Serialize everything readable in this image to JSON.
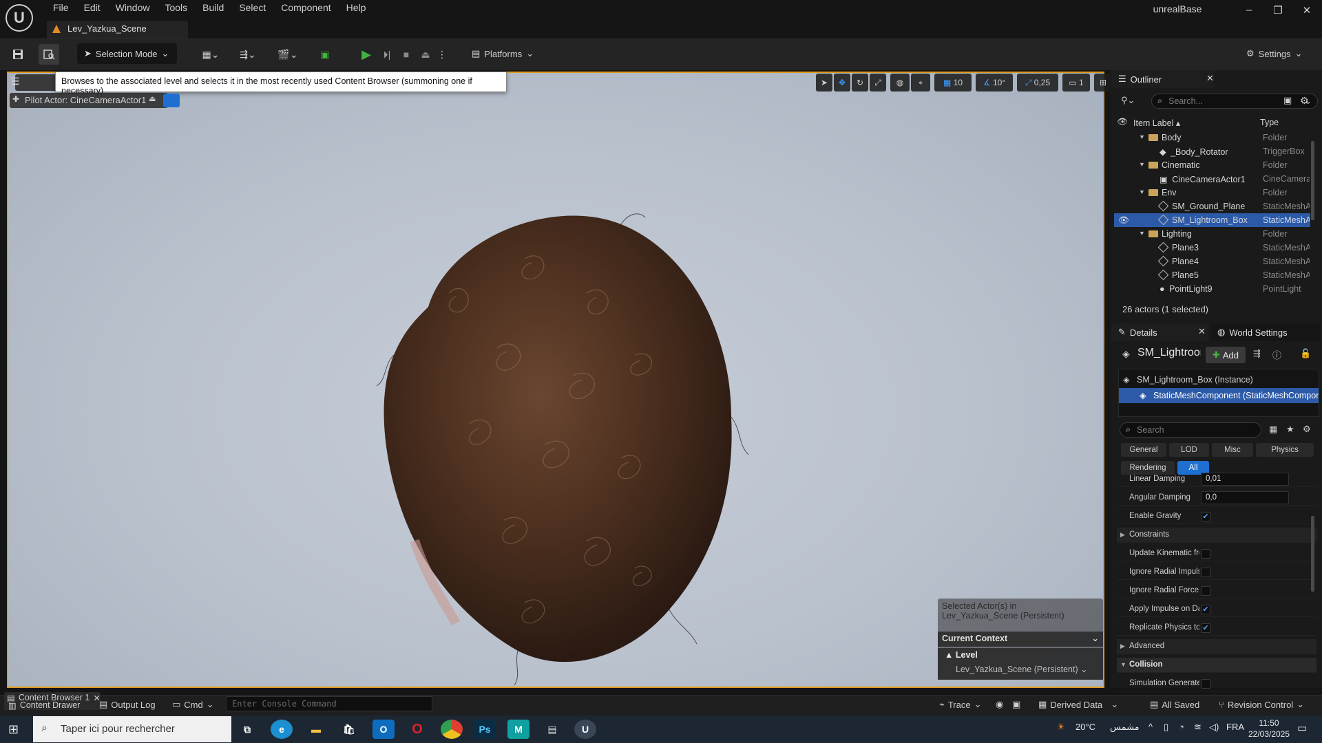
{
  "app": {
    "name": "unrealBase",
    "level_tab": "Lev_Yazkua_Scene",
    "menu": [
      "File",
      "Edit",
      "Window",
      "Tools",
      "Build",
      "Select",
      "Component",
      "Help"
    ],
    "window_controls": [
      "–",
      "❐",
      "✕"
    ]
  },
  "toolbar": {
    "selection_mode": "Selection Mode",
    "platforms": "Platforms",
    "settings": "Settings"
  },
  "viewport": {
    "tooltip": "Browses to the associated level and selects it in the most recently used Content Browser (summoning one if necessary)",
    "pilot_actor": "Pilot Actor: CineCameraActor1",
    "grid_snap": "10",
    "rot_snap": "10°",
    "scale_snap": "0,25",
    "camera_speed": "1",
    "context": {
      "selected_line1": "Selected Actor(s) in",
      "selected_line2": "Lev_Yazkua_Scene (Persistent)",
      "header": "Current Context",
      "level_label": "Level",
      "level_value": "Lev_Yazkua_Scene (Persistent)"
    }
  },
  "outliner": {
    "title": "Outliner",
    "search_placeholder": "Search...",
    "col_label": "Item Label",
    "col_type": "Type",
    "rows": [
      {
        "label": "Body",
        "type": "Folder",
        "kind": "folder",
        "indent": 1
      },
      {
        "label": "_Body_Rotator",
        "type": "TriggerBox",
        "kind": "actor",
        "indent": 2
      },
      {
        "label": "Cinematic",
        "type": "Folder",
        "kind": "folder",
        "indent": 1
      },
      {
        "label": "CineCameraActor1",
        "type": "CineCameraActor",
        "kind": "camera",
        "indent": 2
      },
      {
        "label": "Env",
        "type": "Folder",
        "kind": "folder",
        "indent": 1
      },
      {
        "label": "SM_Ground_Plane",
        "type": "StaticMeshActor",
        "kind": "mesh",
        "indent": 2
      },
      {
        "label": "SM_Lightroom_Box",
        "type": "StaticMeshActor",
        "kind": "mesh",
        "indent": 2,
        "selected": true
      },
      {
        "label": "Lighting",
        "type": "Folder",
        "kind": "folder",
        "indent": 1
      },
      {
        "label": "Plane3",
        "type": "StaticMeshActor",
        "kind": "mesh",
        "indent": 2
      },
      {
        "label": "Plane4",
        "type": "StaticMeshActor",
        "kind": "mesh",
        "indent": 2
      },
      {
        "label": "Plane5",
        "type": "StaticMeshActor",
        "kind": "mesh",
        "indent": 2
      },
      {
        "label": "PointLight9",
        "type": "PointLight",
        "kind": "light",
        "indent": 2
      }
    ],
    "actor_count": "26 actors (1 selected)"
  },
  "details": {
    "tab_title": "Details",
    "world_tab": "World Settings",
    "actor_name": "SM_Lightroom_Box",
    "add_label": "Add",
    "components": [
      {
        "label": "SM_Lightroom_Box (Instance)"
      },
      {
        "label": "StaticMeshComponent (StaticMeshComponent)",
        "selected": true
      }
    ],
    "search_placeholder": "Search",
    "filters": [
      "General",
      "LOD",
      "Misc",
      "Physics",
      "Rendering",
      "All"
    ],
    "active_filter": "All",
    "props": [
      {
        "label": "Linear Damping",
        "kind": "value",
        "value": "0,01"
      },
      {
        "label": "Angular Damping",
        "kind": "value",
        "value": "0,0"
      },
      {
        "label": "Enable Gravity",
        "kind": "check",
        "checked": true
      },
      {
        "label": "Constraints",
        "kind": "category"
      },
      {
        "label": "Update Kinematic from Simulation",
        "kind": "check",
        "checked": false
      },
      {
        "label": "Ignore Radial Impulse",
        "kind": "check",
        "checked": false
      },
      {
        "label": "Ignore Radial Force",
        "kind": "check",
        "checked": false
      },
      {
        "label": "Apply Impulse on Damage",
        "kind": "check",
        "checked": true
      },
      {
        "label": "Replicate Physics to Autonomous Proxy",
        "kind": "check",
        "checked": true
      },
      {
        "label": "Advanced",
        "kind": "category"
      },
      {
        "label": "Collision",
        "kind": "section"
      },
      {
        "label": "Simulation Generates Hit Events",
        "kind": "check",
        "checked": false
      }
    ]
  },
  "statusbar": {
    "content_drawer": "Content Drawer",
    "content_browser_tab": "Content Browser 1",
    "output_log": "Output Log",
    "cmd": "Cmd",
    "console_placeholder": "Enter Console Command",
    "trace": "Trace",
    "derived_data": "Derived Data",
    "all_saved": "All Saved",
    "revision_control": "Revision Control"
  },
  "taskbar": {
    "search_placeholder": "Taper ici pour rechercher",
    "weather": "20°C",
    "weather_text": "مشمس",
    "lang": "FRA",
    "time": "11:50",
    "date": "22/03/2025",
    "apps": [
      "task-view",
      "edge",
      "explorer",
      "store",
      "outlook",
      "opera",
      "chrome",
      "photoshop",
      "maya",
      "tools",
      "unreal"
    ]
  },
  "colors": {
    "accent_blue": "#1f6fd0",
    "viewport_border": "#e09a1a",
    "play_green": "#3fb53f"
  }
}
